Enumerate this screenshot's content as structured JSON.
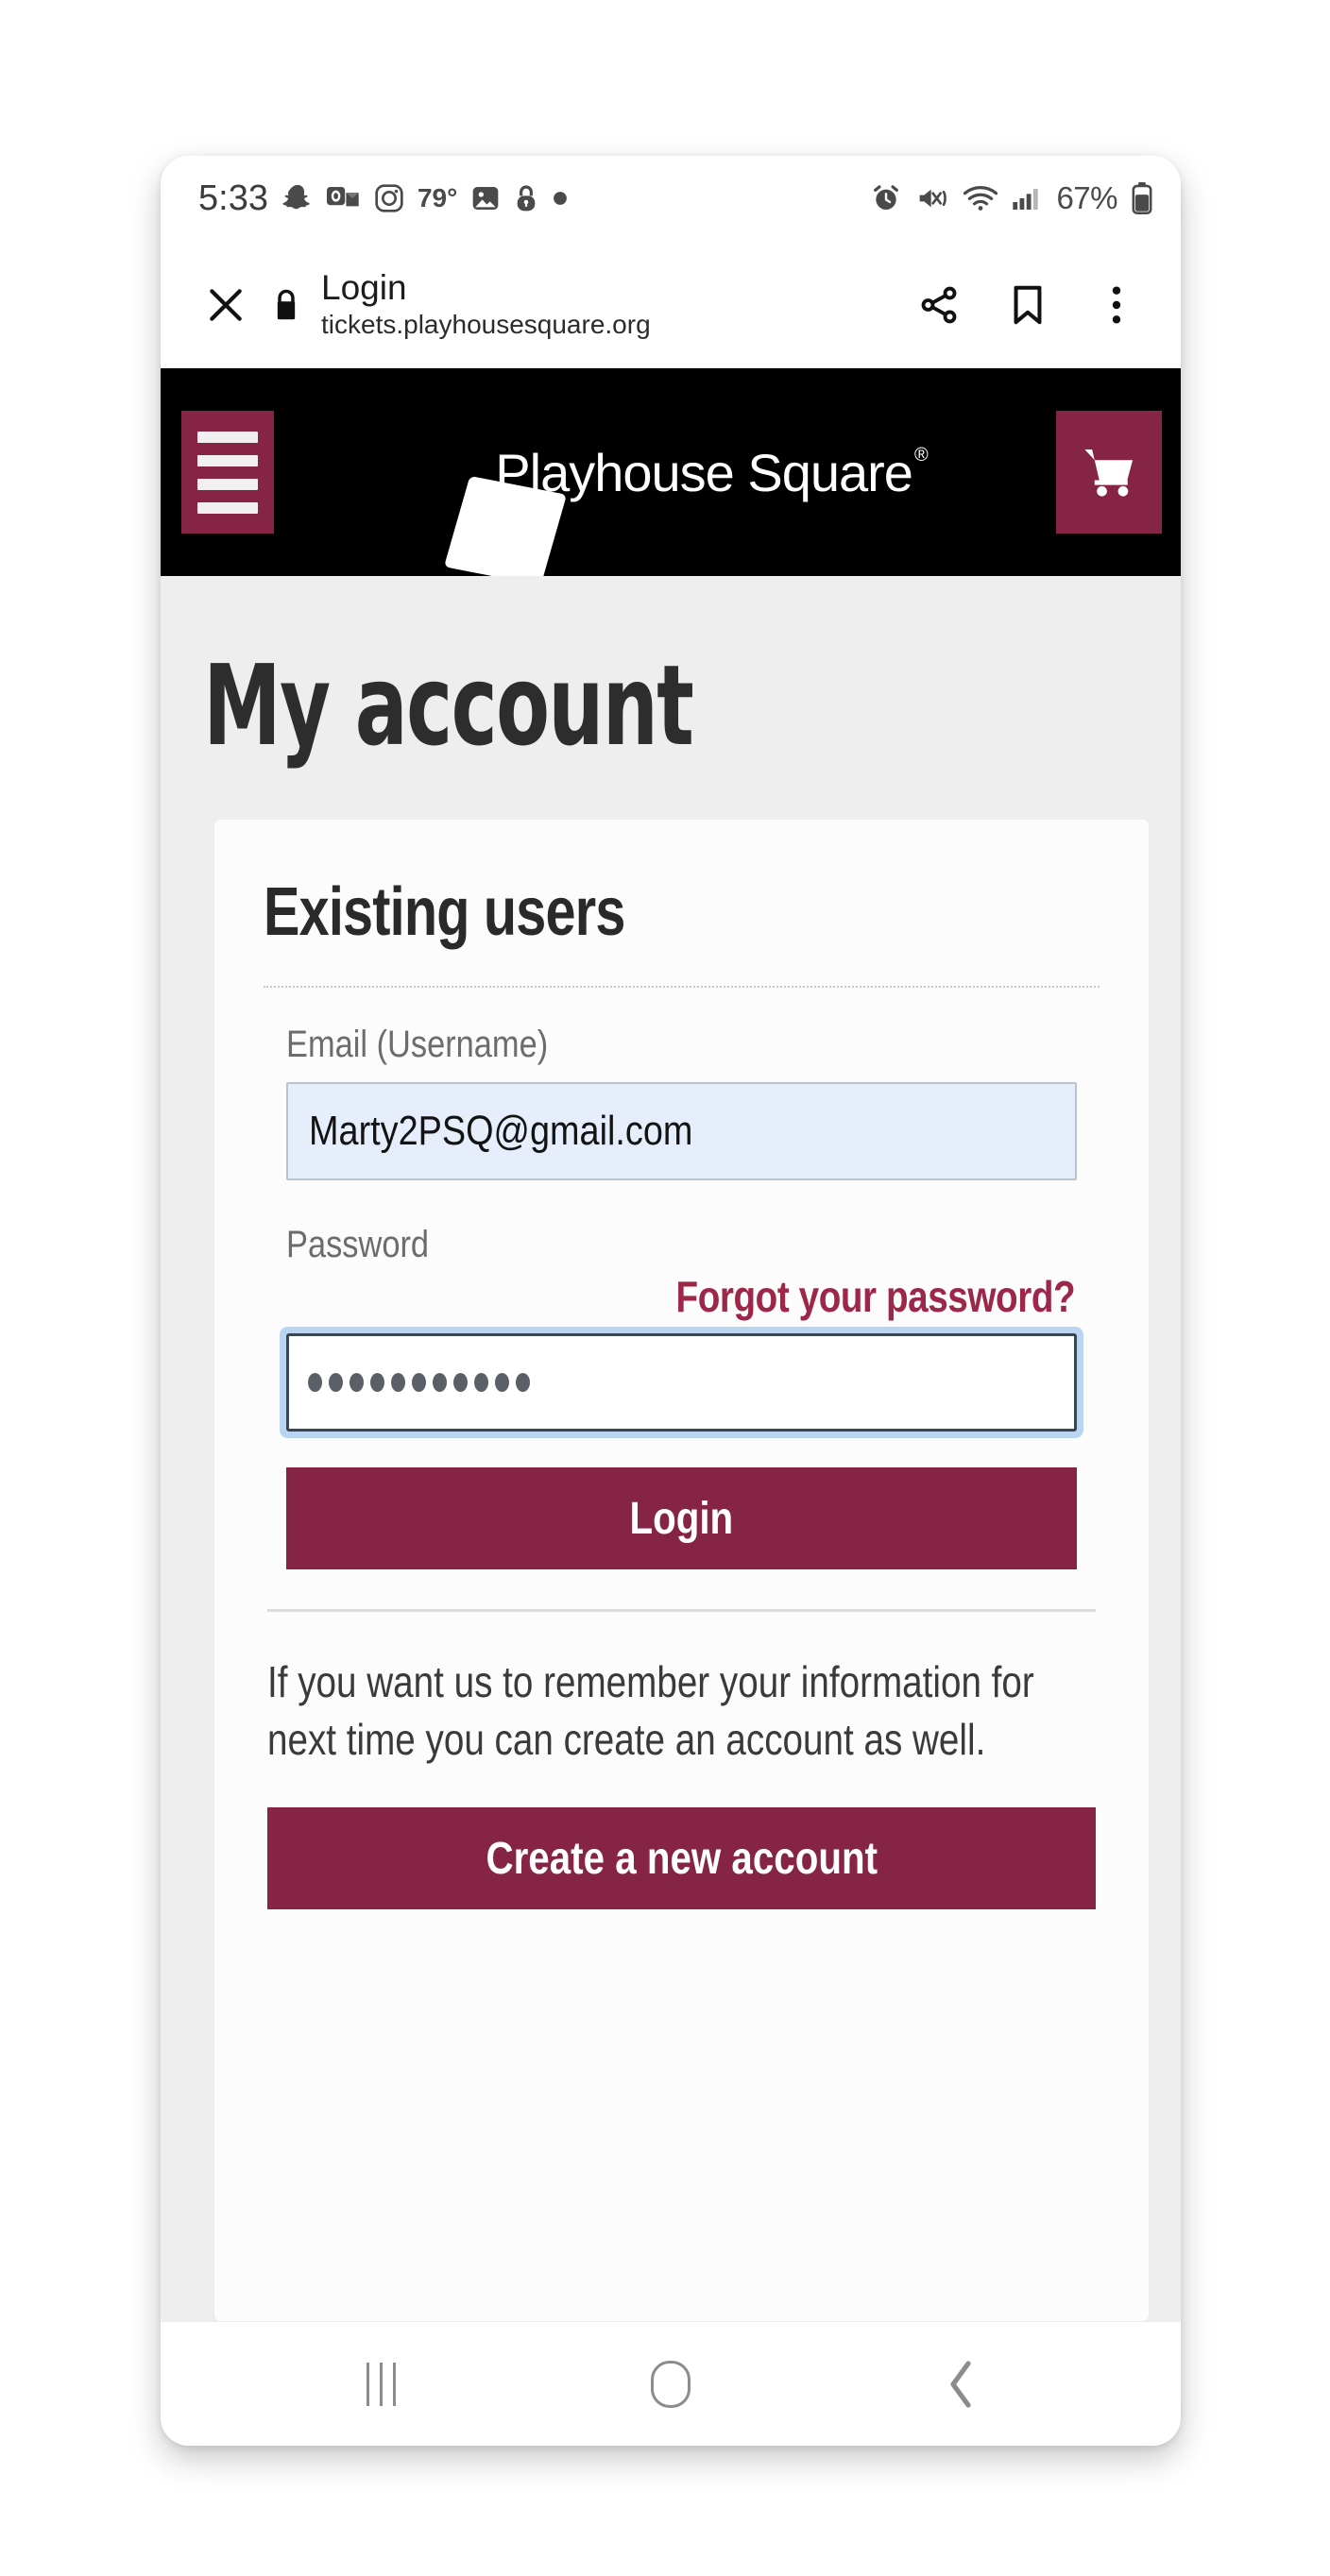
{
  "status_bar": {
    "clock": "5:33",
    "temperature": "79°",
    "battery_percent": "67%",
    "left_icons": [
      "snapchat-icon",
      "outlook-icon",
      "instagram-icon",
      "gallery-icon",
      "lock-icon",
      "dot-icon"
    ],
    "right_icons": [
      "alarm-icon",
      "mute-vibrate-icon",
      "wifi-icon",
      "cellular-signal-icon",
      "battery-icon"
    ]
  },
  "browser_bar": {
    "close_label": "close-tab",
    "security_icon": "lock-icon",
    "page_title": "Login",
    "page_url": "tickets.playhousesquare.org",
    "share_label": "share",
    "bookmark_label": "bookmark",
    "menu_label": "more-options"
  },
  "site_header": {
    "menu_label": "menu",
    "logo_text": "Playhouse Square",
    "logo_trademark": "®",
    "cart_label": "cart"
  },
  "page": {
    "title": "My account"
  },
  "card": {
    "title": "Existing users",
    "email_label": "Email (Username)",
    "email_value": "Marty2PSQ@gmail.com",
    "password_label": "Password",
    "forgot_link": "Forgot your password?",
    "password_dots": 11,
    "login_button": "Login",
    "promo_line1": "If you want us to remember your information for",
    "promo_line2": "next time you can create an account as well.",
    "create_button": "Create a new account"
  },
  "nav_bar": {
    "recents_label": "recents",
    "home_label": "home",
    "back_label": "back"
  },
  "colors": {
    "brand_maroon": "#862446",
    "link_maroon": "#9d2749",
    "header_black": "#000000",
    "page_bg": "#eeeeee",
    "card_bg": "#fcfcfc",
    "autofill_blue": "#e7eefb",
    "focus_ring": "#b9d5f2"
  }
}
